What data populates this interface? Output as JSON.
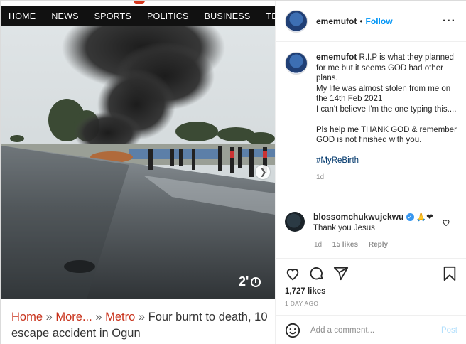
{
  "news_nav": {
    "items": [
      "HOME",
      "NEWS",
      "SPORTS",
      "POLITICS",
      "BUSINESS",
      "TECH"
    ]
  },
  "media": {
    "timer": "2'",
    "next_icon": "chevron-right-icon"
  },
  "headline": {
    "crumb_home": "Home",
    "sep": " » ",
    "crumb_more": "More...",
    "crumb_metro": "Metro",
    "title": "Four burnt to death, 10 escape accident in Ogun"
  },
  "post": {
    "username": "ememufot",
    "dot": "•",
    "follow_label": "Follow",
    "caption": {
      "username": "ememufot",
      "line1": "R.I.P is what they planned for me but it seems GOD had other plans.",
      "line2": "My life was almost stolen from me on the 14th Feb 2021",
      "line3": "I can't believe I'm the one typing this....",
      "line4": "Pls help me THANK GOD & remember GOD is not finished with you.",
      "hashtag": "#MyReBirth",
      "time": "1d"
    },
    "comment": {
      "username": "blossomchukwujekwu",
      "emojis": "🙏❤",
      "text": "Thank you Jesus",
      "time": "1d",
      "likes": "15 likes",
      "reply": "Reply"
    },
    "likes": "1,727 likes",
    "time_ago": "1 DAY AGO",
    "add_comment_placeholder": "Add a comment...",
    "post_label": "Post"
  }
}
